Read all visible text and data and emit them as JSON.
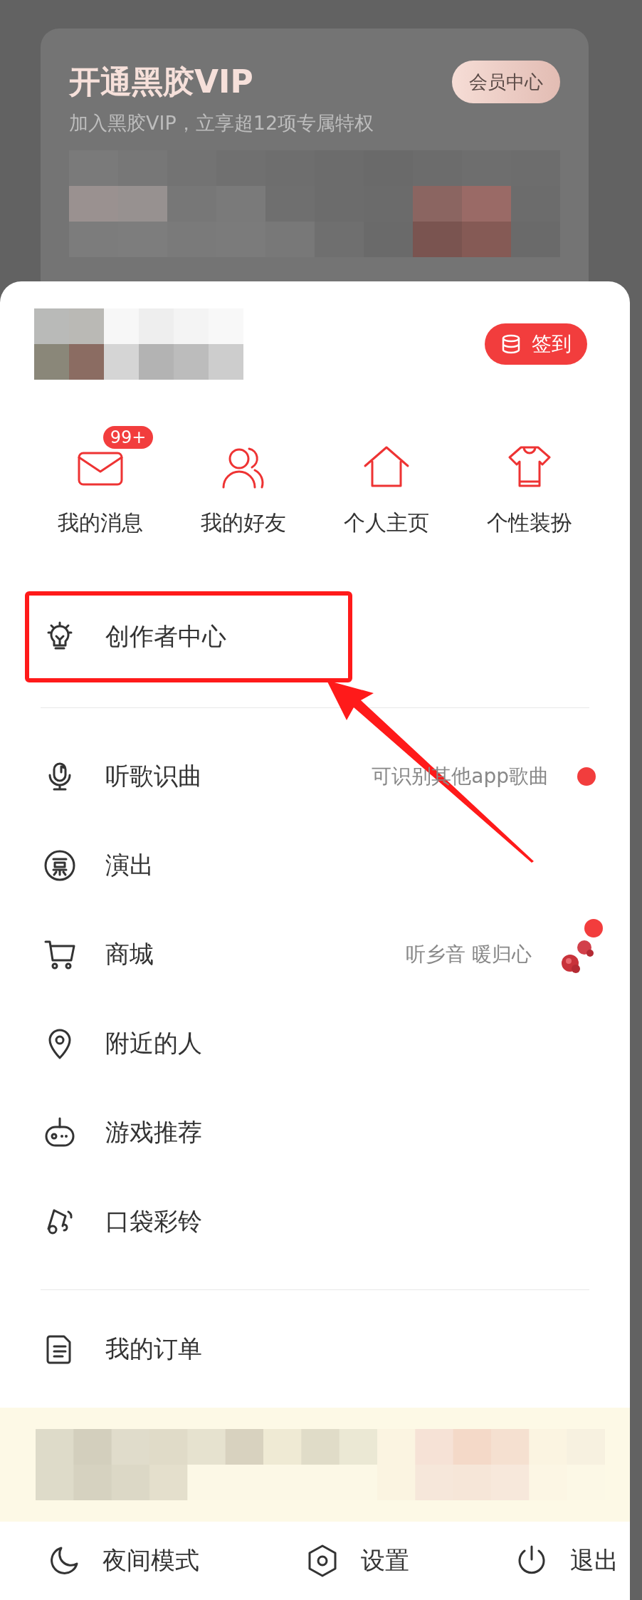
{
  "vip_card": {
    "title": "开通黑胶VIP",
    "subtitle": "加入黑胶VIP，立享超12项专属特权",
    "button": "会员中心"
  },
  "profile": {
    "checkin_button": "签到"
  },
  "shortcuts": [
    {
      "kind": "mail",
      "label": "我的消息",
      "badge": "99+"
    },
    {
      "kind": "friends",
      "label": "我的好友"
    },
    {
      "kind": "home",
      "label": "个人主页"
    },
    {
      "kind": "shirt",
      "label": "个性装扮"
    }
  ],
  "menu_sections": [
    [
      {
        "kind": "bulb",
        "label": "创作者中心",
        "highlighted": true,
        "dot": false
      }
    ],
    [
      {
        "kind": "mic",
        "label": "听歌识曲",
        "hint": "可识别其他app歌曲",
        "highlighted": false,
        "dot": true
      },
      {
        "kind": "ticket",
        "label": "演出",
        "highlighted": false,
        "dot": false
      },
      {
        "kind": "cart",
        "label": "商城",
        "hint": "听乡音 暖归心",
        "picture": true,
        "highlighted": false,
        "dot": true
      },
      {
        "kind": "pin",
        "label": "附近的人",
        "highlighted": false,
        "dot": false
      },
      {
        "kind": "game",
        "label": "游戏推荐",
        "highlighted": false,
        "dot": false
      },
      {
        "kind": "ring",
        "label": "口袋彩铃",
        "highlighted": false,
        "dot": false
      }
    ],
    [
      {
        "kind": "doc",
        "label": "我的订单",
        "highlighted": false,
        "dot": false
      }
    ]
  ],
  "bottom_bar": [
    {
      "kind": "moon",
      "label": "夜间模式"
    },
    {
      "kind": "hex",
      "label": "设置"
    },
    {
      "kind": "power",
      "label": "退出"
    }
  ]
}
